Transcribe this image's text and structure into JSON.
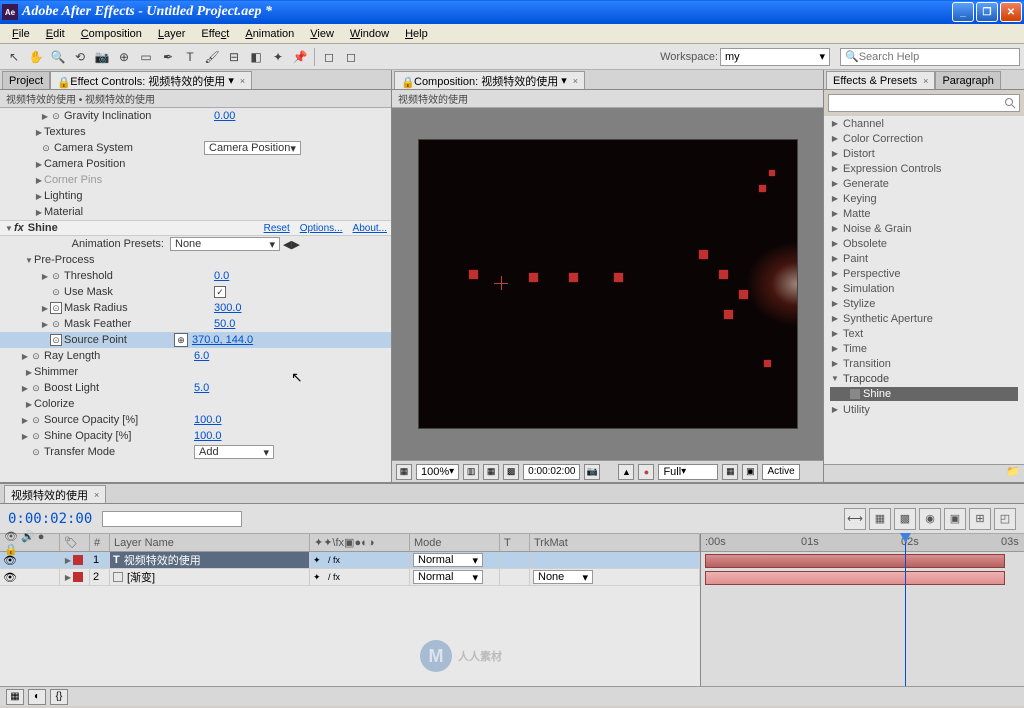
{
  "title": "Adobe After Effects - Untitled Project.aep *",
  "menus": [
    "File",
    "Edit",
    "Composition",
    "Layer",
    "Effect",
    "Animation",
    "View",
    "Window",
    "Help"
  ],
  "workspace": {
    "label": "Workspace:",
    "value": "my"
  },
  "search_placeholder": "Search Help",
  "tabs_left": {
    "project": "Project",
    "ec": "Effect Controls: 视频特效的使用"
  },
  "ec_title": "视频特效的使用 • 视频特效的使用",
  "ec": {
    "gravity": {
      "label": "Gravity Inclination",
      "val": "0.00"
    },
    "textures": "Textures",
    "camera_system": {
      "label": "Camera System",
      "val": "Camera Position"
    },
    "camera_position": "Camera Position",
    "corner_pins": "Corner Pins",
    "lighting": "Lighting",
    "material": "Material",
    "shine": {
      "name": "Shine",
      "reset": "Reset",
      "options": "Options...",
      "about": "About...",
      "presets_label": "Animation Presets:",
      "presets_val": "None",
      "preprocess": "Pre-Process",
      "threshold": {
        "label": "Threshold",
        "val": "0.0"
      },
      "use_mask": {
        "label": "Use Mask",
        "checked": true
      },
      "mask_radius": {
        "label": "Mask Radius",
        "val": "300.0"
      },
      "mask_feather": {
        "label": "Mask Feather",
        "val": "50.0"
      },
      "source_point": {
        "label": "Source Point",
        "val": "370.0, 144.0"
      },
      "ray_length": {
        "label": "Ray Length",
        "val": "6.0"
      },
      "shimmer": "Shimmer",
      "boost_light": {
        "label": "Boost Light",
        "val": "5.0"
      },
      "colorize": "Colorize",
      "source_opacity": {
        "label": "Source Opacity [%]",
        "val": "100.0"
      },
      "shine_opacity": {
        "label": "Shine Opacity [%]",
        "val": "100.0"
      },
      "transfer_mode": {
        "label": "Transfer Mode",
        "val": "Add"
      }
    }
  },
  "comp_tab": "Composition: 视频特效的使用",
  "comp_header": "视频特效的使用",
  "comp_footer": {
    "mag": "100%",
    "time": "0:00:02:00",
    "res": "Full",
    "view": "Active"
  },
  "ep_tabs": {
    "ep": "Effects & Presets",
    "para": "Paragraph"
  },
  "ep_items": [
    "Channel",
    "Color Correction",
    "Distort",
    "Expression Controls",
    "Generate",
    "Keying",
    "Matte",
    "Noise & Grain",
    "Obsolete",
    "Paint",
    "Perspective",
    "Simulation",
    "Stylize",
    "Synthetic Aperture",
    "Text",
    "Time",
    "Transition"
  ],
  "ep_expanded": {
    "name": "Trapcode",
    "child": "Shine"
  },
  "ep_last": "Utility",
  "tl_tab": "视频特效的使用",
  "tl_time": "0:00:02:00",
  "tl_cols": {
    "layer_name": "Layer Name",
    "mode": "Mode",
    "trkmat": "TrkMat"
  },
  "tl_ruler": {
    "t0": ":00s",
    "t1": "01s",
    "t2": "02s",
    "t3": "03s"
  },
  "layers": [
    {
      "num": "1",
      "name": "视频特效的使用",
      "type": "T",
      "mode": "Normal",
      "trkmat": ""
    },
    {
      "num": "2",
      "name": "[渐变]",
      "type": "",
      "mode": "Normal",
      "trkmat": "None"
    }
  ],
  "watermark": "人人素材"
}
